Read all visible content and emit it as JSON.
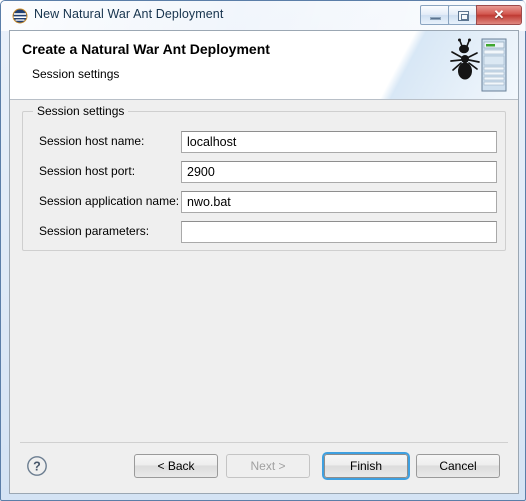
{
  "window": {
    "title": "New Natural War Ant Deployment",
    "title_icon": "natural-logo-icon",
    "controls": {
      "minimize": "minimize-icon",
      "maximize": "maximize-icon",
      "close_glyph": "✕"
    }
  },
  "header": {
    "title": "Create a Natural War Ant Deployment",
    "subtitle": "Session settings",
    "icon": "ant-server-icon"
  },
  "group": {
    "title": "Session settings",
    "fields": [
      {
        "label": "Session host name:",
        "value": "localhost",
        "placeholder": ""
      },
      {
        "label": "Session host port:",
        "value": "2900",
        "placeholder": ""
      },
      {
        "label": "Session application name:",
        "value": "nwo.bat",
        "placeholder": ""
      },
      {
        "label": "Session parameters:",
        "value": "",
        "placeholder": ""
      }
    ]
  },
  "buttons": {
    "help": "?",
    "back": "< Back",
    "next": "Next >",
    "finish": "Finish",
    "cancel": "Cancel"
  },
  "colors": {
    "focus_ring": "#3fa0e0",
    "close_button": "#bf3a33",
    "body_background": "#efefef",
    "title_text": "#16334d"
  }
}
